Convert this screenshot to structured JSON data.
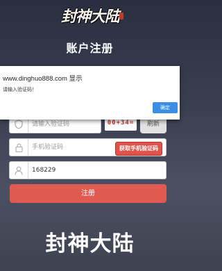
{
  "brand": {
    "logo_text": "封神大陆"
  },
  "page": {
    "title": "账户注册"
  },
  "form": {
    "captcha": {
      "placeholder": "请输入验证码",
      "image_text": "00+34=",
      "refresh_label": "刷新"
    },
    "phone_code": {
      "placeholder": "手机验证码",
      "send_label": "获取手机验证码"
    },
    "user": {
      "value": "168229"
    },
    "submit_label": "注册"
  },
  "footer": {
    "brand_text": "封神大陆"
  },
  "dialog": {
    "origin": "www.dinghuo888.com 显示",
    "message": "请输入验证码！",
    "ok_label": "确定"
  },
  "colors": {
    "primary": "#e15a52",
    "dialog_button": "#3a8ee6"
  }
}
